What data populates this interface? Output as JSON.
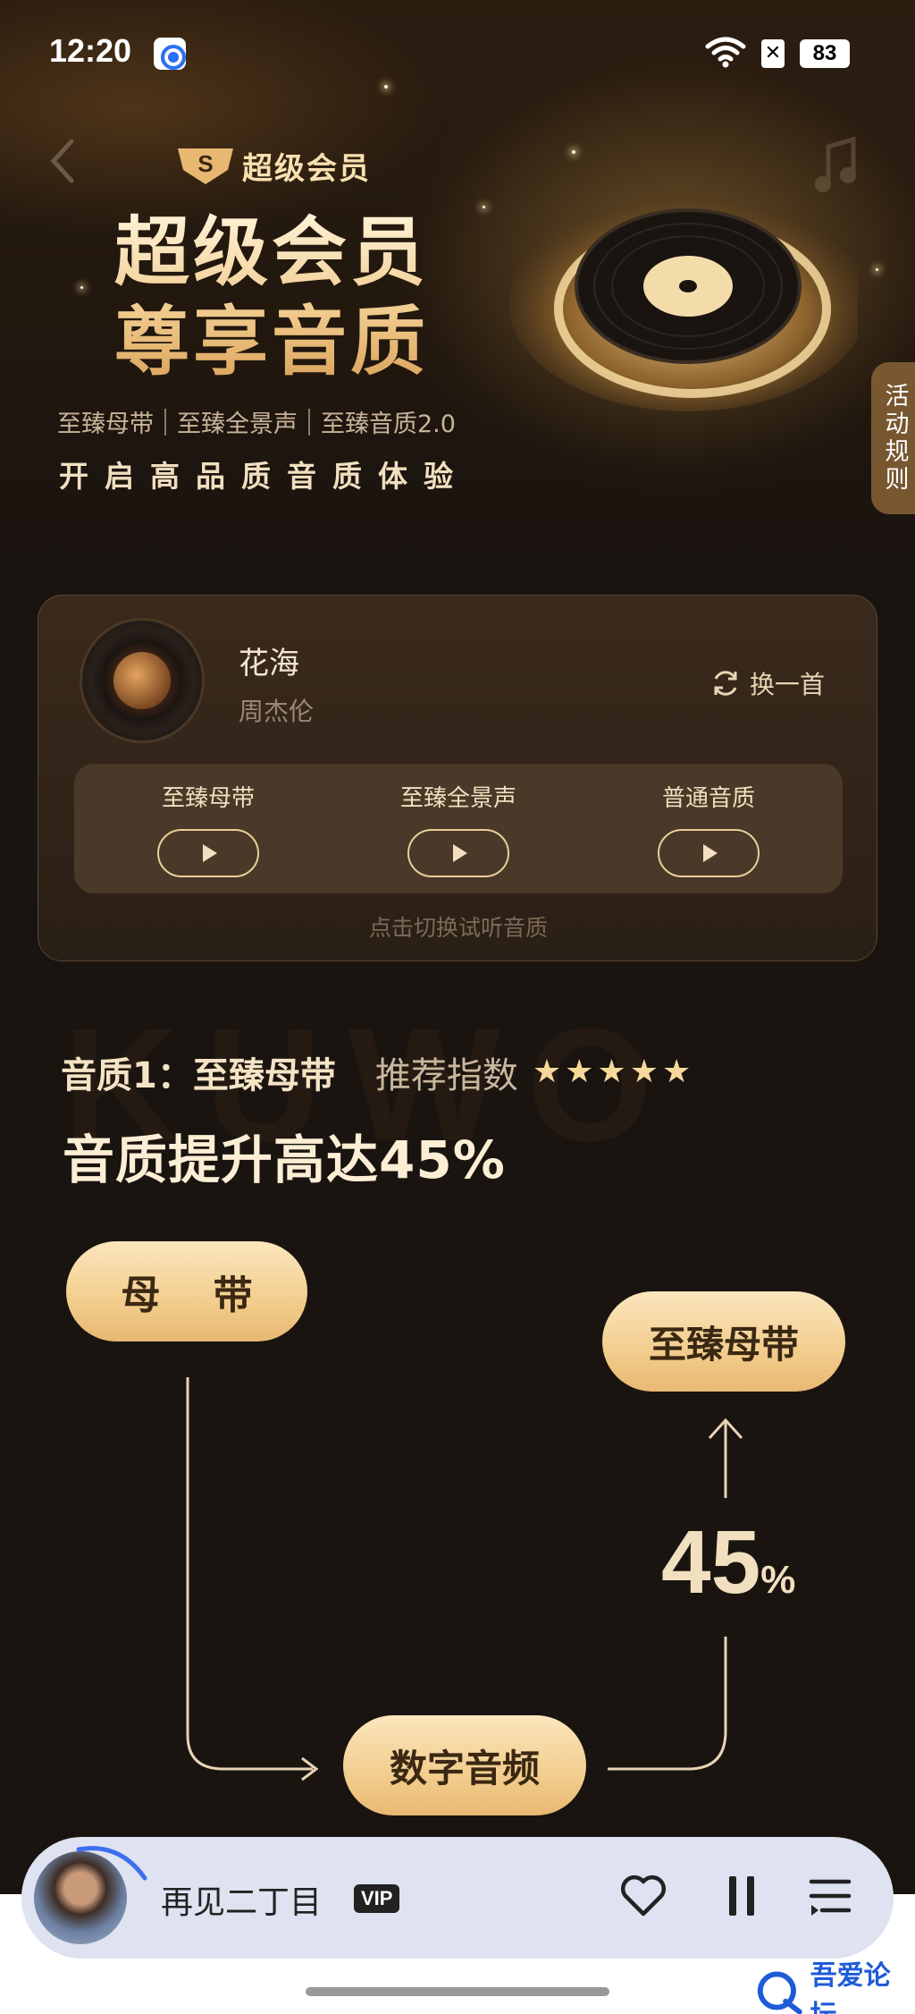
{
  "status_bar": {
    "time": "12:20",
    "sim": "✕",
    "battery": "83"
  },
  "hero": {
    "logo_text": "超级会员",
    "logo_badge": "S",
    "title_line1": "超级会员",
    "title_line2": "尊享音质",
    "features": [
      "至臻母带",
      "至臻全景声",
      "至臻音质2.0"
    ],
    "tagline": "开启高品质音质体验",
    "rules_tab": "活动规则"
  },
  "song_card": {
    "title": "花海",
    "artist": "周杰伦",
    "switch_label": "换一首",
    "qualities": [
      {
        "label": "至臻母带"
      },
      {
        "label": "至臻全景声"
      },
      {
        "label": "普通音质"
      }
    ],
    "hint": "点击切换试听音质"
  },
  "quality_detail": {
    "watermark": "KUWO",
    "name": "音质1：至臻母带",
    "recommend_label": "推荐指数",
    "stars": 5,
    "headline": "音质提升高达45%",
    "flow": {
      "tape": "母 带",
      "digital": "数字音频",
      "supreme": "至臻母带",
      "percent_value": "45",
      "percent_unit": "%"
    }
  },
  "mini_player": {
    "title": "再见二丁目",
    "vip_badge": "VIP"
  },
  "corner_mark": {
    "text": "吾爱论坛"
  },
  "colors": {
    "gold": "#f2cd8d",
    "background": "#1a1410",
    "card": "#3a2a1c"
  }
}
